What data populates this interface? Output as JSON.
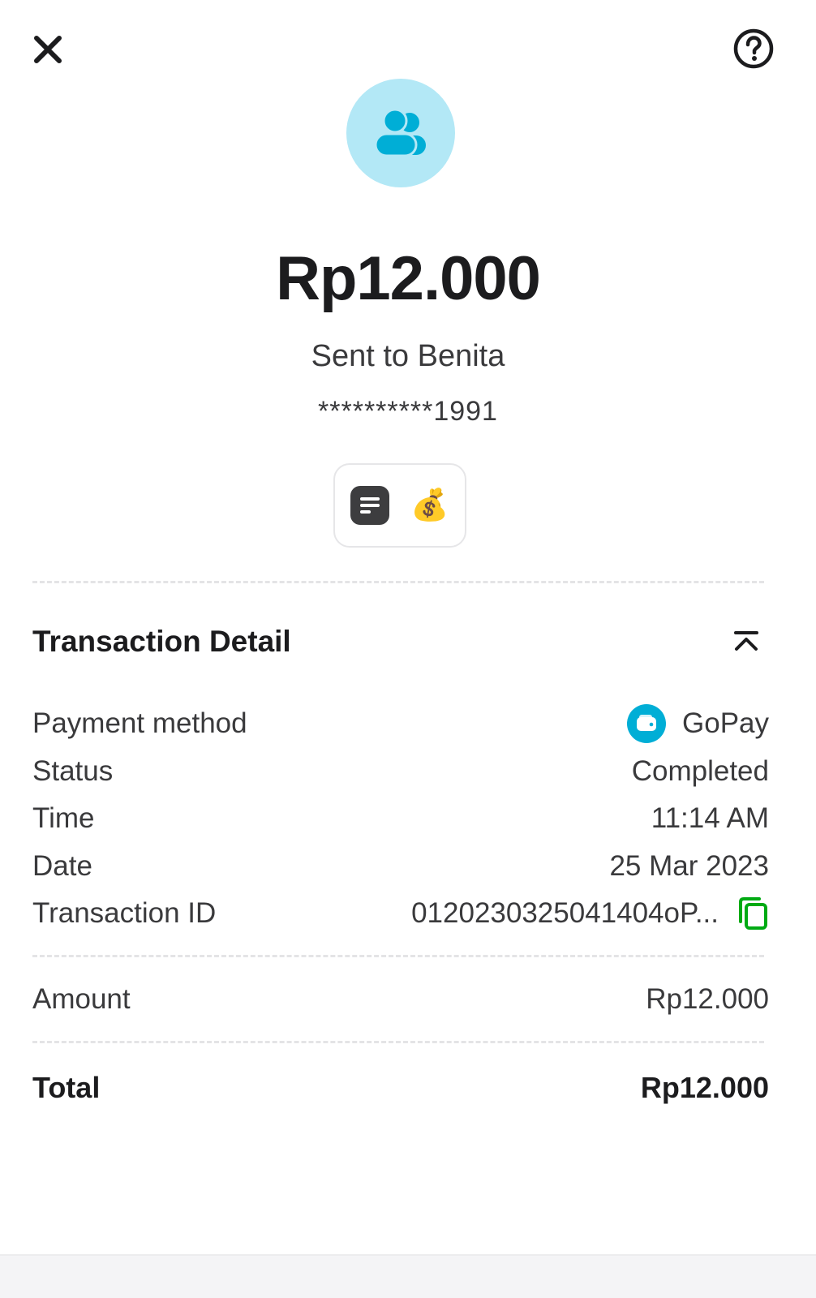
{
  "header": {
    "close_icon": "close-icon",
    "help_icon": "help-circle-icon"
  },
  "recipient": {
    "avatar_icon": "people-icon",
    "avatar_color": "#b3e8f6",
    "icon_color": "#00aed6"
  },
  "transfer": {
    "amount": "Rp12.000",
    "sent_to": "Sent to Benita",
    "account_number": "**********1991",
    "note_icon": "note-icon",
    "note_emoji": "💰"
  },
  "details": {
    "title": "Transaction Detail",
    "collapse_icon": "collapse-up-icon",
    "payment_method_label": "Payment method",
    "payment_method_value": "GoPay",
    "payment_method_icon": "wallet-icon",
    "status_label": "Status",
    "status_value": "Completed",
    "time_label": "Time",
    "time_value": "11:14 AM",
    "date_label": "Date",
    "date_value": "25 Mar 2023",
    "transaction_id_label": "Transaction ID",
    "transaction_id_value": "0120230325041404oP...",
    "copy_icon": "copy-icon",
    "copy_color": "#00aa13"
  },
  "summary": {
    "amount_label": "Amount",
    "amount_value": "Rp12.000",
    "total_label": "Total",
    "total_value": "Rp12.000"
  }
}
